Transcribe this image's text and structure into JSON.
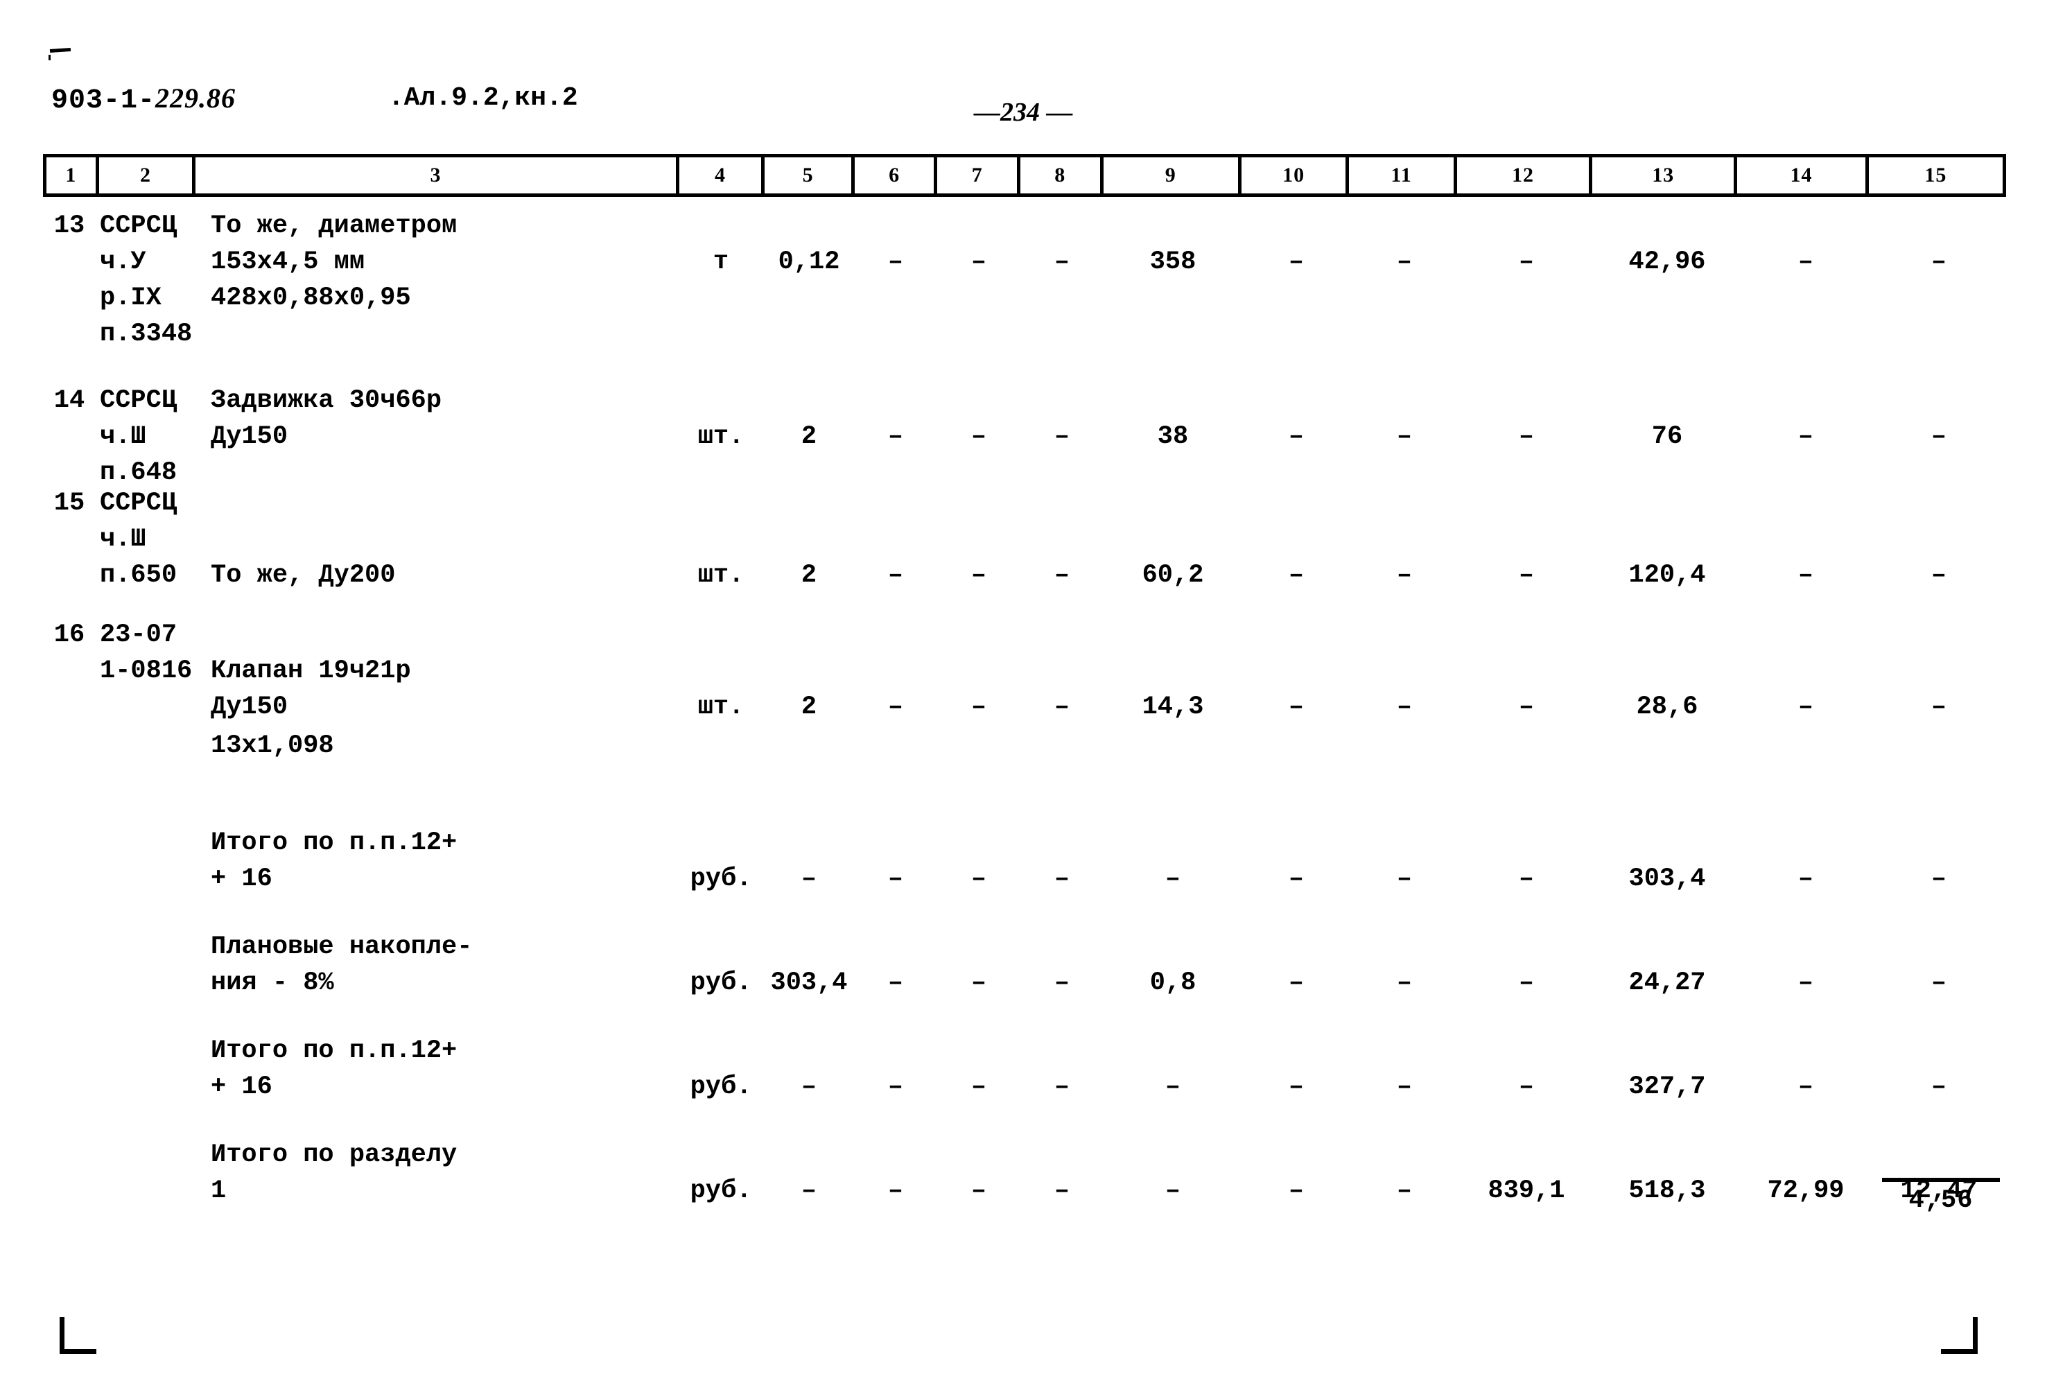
{
  "header": {
    "doc_code_prefix": "903-1-",
    "doc_code_suffix": "229.86",
    "album": ".Ал.9.2,кн.2",
    "page_number": "—234 —"
  },
  "table": {
    "column_numbers": [
      "1",
      "2",
      "3",
      "4",
      "5",
      "6",
      "7",
      "8",
      "9",
      "10",
      "11",
      "12",
      "13",
      "14",
      "15"
    ],
    "rows": [
      {
        "no": "13",
        "code": "ССРСЦ\nч.У\nр.IX\nп.3348",
        "name": "То же, диаметром\n153х4,5 мм\n428х0,88х0,95",
        "unit": "т",
        "c5": "0,12",
        "c6": "–",
        "c7": "–",
        "c8": "–",
        "c9": "358",
        "c10": "–",
        "c11": "–",
        "c12": "–",
        "c13": "42,96",
        "c14": "–",
        "c15": "–"
      },
      {
        "no": "14",
        "code": "ССРСЦ\nч.Ш\nп.648",
        "name": "Задвижка 30ч66р\nДу150",
        "unit": "шт.",
        "c5": "2",
        "c6": "–",
        "c7": "–",
        "c8": "–",
        "c9": "38",
        "c10": "–",
        "c11": "–",
        "c12": "–",
        "c13": "76",
        "c14": "–",
        "c15": "–"
      },
      {
        "no": "15",
        "code": "ССРСЦ\nч.Ш\nп.650",
        "name": "То же, Ду200",
        "unit": "шт.",
        "c5": "2",
        "c6": "–",
        "c7": "–",
        "c8": "–",
        "c9": "60,2",
        "c10": "–",
        "c11": "–",
        "c12": "–",
        "c13": "120,4",
        "c14": "–",
        "c15": "–"
      },
      {
        "no": "16",
        "code": "23-07\n1-0816",
        "name": "Клапан 19ч21р\nДу150",
        "name2": "13х1,098",
        "unit": "шт.",
        "c5": "2",
        "c6": "–",
        "c7": "–",
        "c8": "–",
        "c9": "14,3",
        "c10": "–",
        "c11": "–",
        "c12": "–",
        "c13": "28,6",
        "c14": "–",
        "c15": "–"
      }
    ],
    "summary_rows": [
      {
        "name": "Итого по п.п.12+\n+ 16",
        "unit": "руб.",
        "c5": "–",
        "c6": "–",
        "c7": "–",
        "c8": "–",
        "c9": "–",
        "c10": "–",
        "c11": "–",
        "c12": "–",
        "c13": "303,4",
        "c14": "–",
        "c15": "–"
      },
      {
        "name": "Плановые накопле-\nния - 8%",
        "unit": "руб.",
        "c5": "303,4",
        "c6": "–",
        "c7": "–",
        "c8": "–",
        "c9": "0,8",
        "c10": "–",
        "c11": "–",
        "c12": "–",
        "c13": "24,27",
        "c14": "–",
        "c15": "–"
      },
      {
        "name": "Итого по п.п.12+\n+ 16",
        "unit": "руб.",
        "c5": "–",
        "c6": "–",
        "c7": "–",
        "c8": "–",
        "c9": "–",
        "c10": "–",
        "c11": "–",
        "c12": "–",
        "c13": "327,7",
        "c14": "–",
        "c15": "–"
      },
      {
        "name": "Итого по разделу\n1",
        "unit": "руб.",
        "c5": "–",
        "c6": "–",
        "c7": "–",
        "c8": "–",
        "c9": "–",
        "c10": "–",
        "c11": "–",
        "c12": "839,1",
        "c13": "518,3",
        "c14": "72,99",
        "c15": "12,47"
      }
    ],
    "fraction_total": "4,56"
  }
}
